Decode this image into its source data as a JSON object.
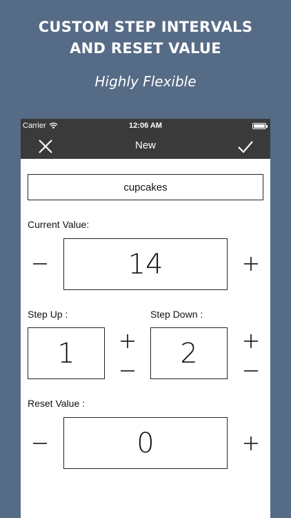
{
  "promo": {
    "headline_line1": "CUSTOM STEP INTERVALS",
    "headline_line2": "AND RESET VALUE",
    "subline": "Highly Flexible"
  },
  "status_bar": {
    "carrier": "Carrier",
    "time": "12:06 AM"
  },
  "nav": {
    "title": "New",
    "close_icon": "close-icon",
    "done_icon": "checkmark-icon"
  },
  "form": {
    "name_value": "cupcakes",
    "current_value_label": "Current Value:",
    "current_value": "14",
    "step_up_label": "Step Up :",
    "step_up_value": "1",
    "step_down_label": "Step Down :",
    "step_down_value": "2",
    "reset_value_label": "Reset Value :",
    "reset_value": "0"
  },
  "colors": {
    "background": "#566b86",
    "bar": "#3a3a3a",
    "content": "#ffffff"
  }
}
